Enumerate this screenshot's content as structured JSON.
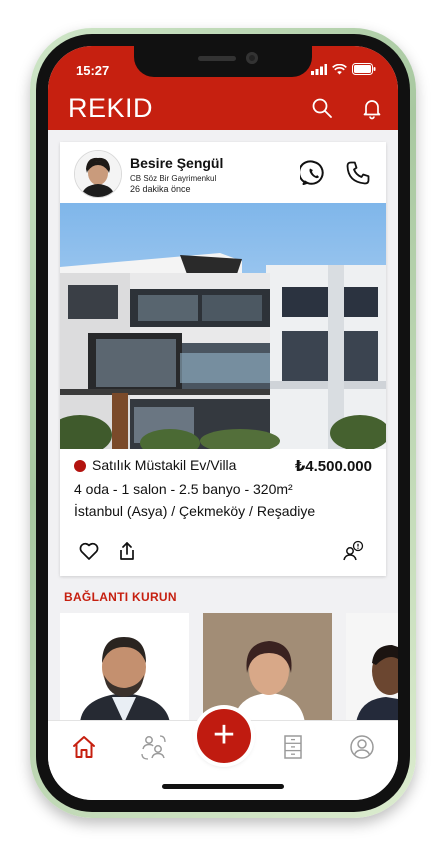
{
  "status_bar": {
    "time": "15:27"
  },
  "app": {
    "brand": "REKID",
    "accent_color": "#c62010"
  },
  "header": {
    "icons": [
      "search-icon",
      "bell-icon"
    ]
  },
  "listing": {
    "agent_name": "Besire Şengül",
    "agent_company": "CB Söz Bir Gayrimenkul",
    "posted_time": "26 dakika önce",
    "listing_type": "Satılık Müstakil Ev/Villa",
    "price": "₺4.500.000",
    "specs": "4 oda - 1 salon - 2.5 banyo - 320m²",
    "location": "İstanbul (Asya) / Çekmeköy / Reşadiye",
    "contact_icons": [
      "whatsapp-icon",
      "phone-icon"
    ],
    "action_icons": [
      "heart-icon",
      "share-icon",
      "contact-person-icon"
    ]
  },
  "connect_section": {
    "title": "BAĞLANTI KURUN"
  },
  "tabbar": {
    "icons": [
      "home-icon",
      "connections-icon",
      "add-icon",
      "listings-icon",
      "profile-icon"
    ],
    "add_label": "+"
  }
}
